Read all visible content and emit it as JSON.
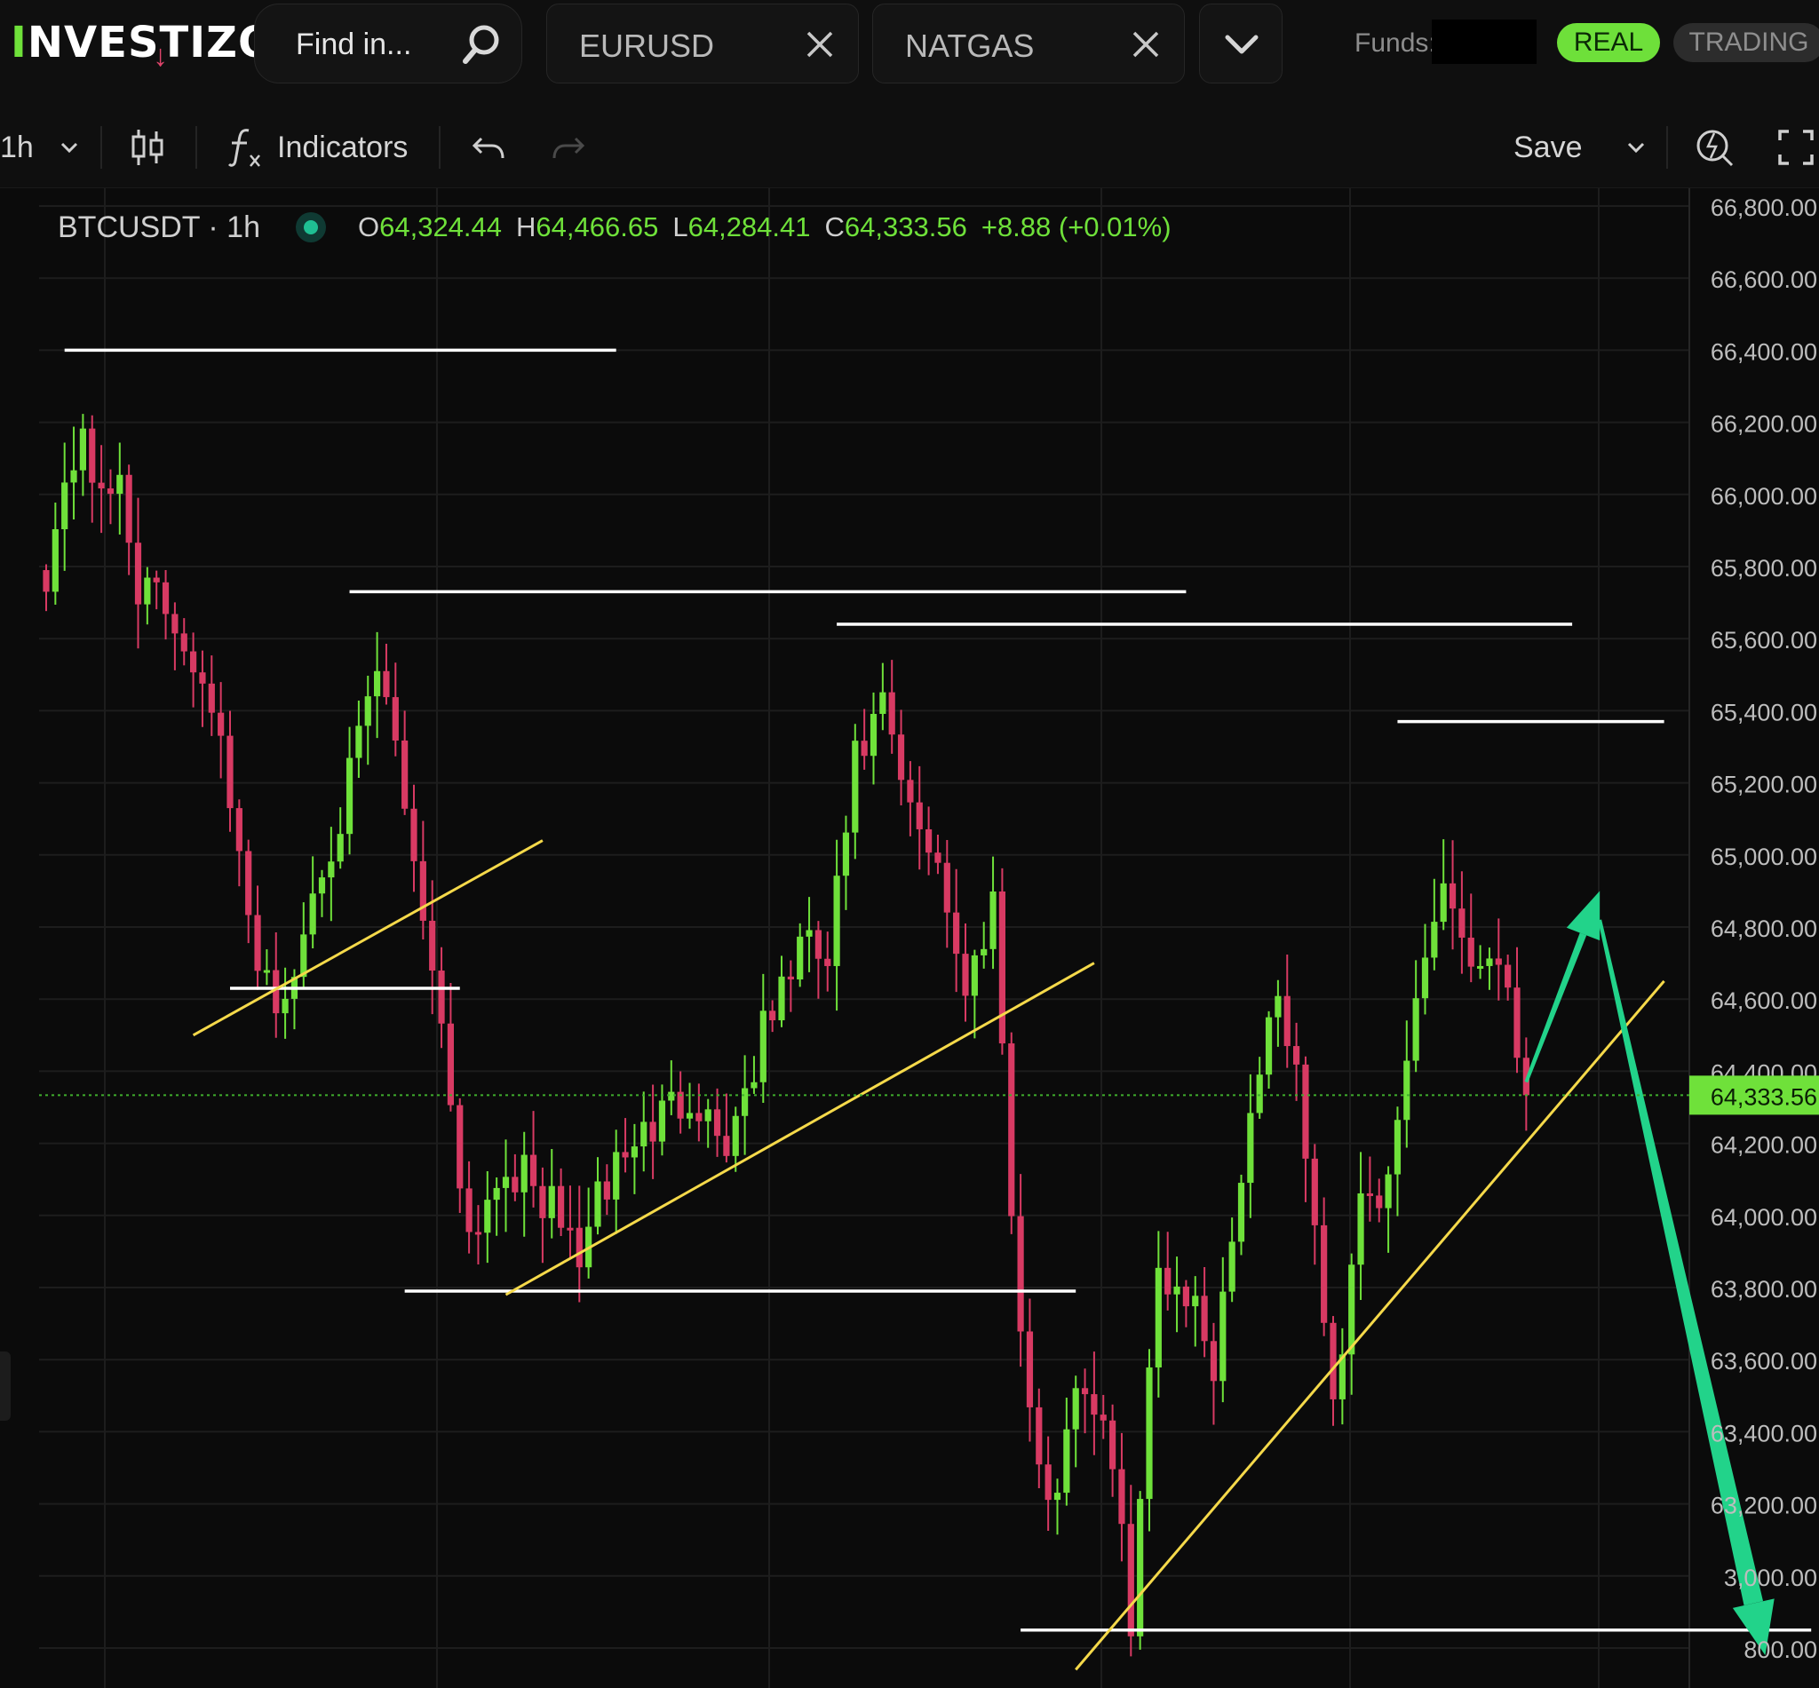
{
  "brand": {
    "first": "I",
    "rest": "NVESTIZO",
    "arrow": "↓"
  },
  "search": {
    "placeholder": "Find in..."
  },
  "tabs": [
    {
      "label": "EURUSD"
    },
    {
      "label": "NATGAS"
    }
  ],
  "account": {
    "funds_label": "Funds:",
    "real_label": "REAL",
    "trading_label": "TRADING"
  },
  "toolbar": {
    "interval": "1h",
    "indicators_label": "Indicators",
    "save_label": "Save"
  },
  "legend": {
    "symbol": "BTCUSDT · 1h",
    "o_key": "O",
    "o_val": "64,324.44",
    "h_key": "H",
    "h_val": "64,466.65",
    "l_key": "L",
    "l_val": "64,284.41",
    "c_key": "C",
    "c_val": "64,333.56",
    "change": "+8.88 (+0.01%)"
  },
  "colors": {
    "up": "#6fe13a",
    "down": "#d83a63",
    "support_line": "#ffffff",
    "trend_line": "#f5d94a",
    "arrow": "#22d38a",
    "bg": "#0b0b0b"
  },
  "chart_data": {
    "type": "candlestick",
    "symbol": "BTCUSDT",
    "interval": "1h",
    "y_axis": {
      "min": 62700,
      "max": 66900,
      "ticks": [
        {
          "value": 66800,
          "label": "66,800.00"
        },
        {
          "value": 66600,
          "label": "66,600.00"
        },
        {
          "value": 66400,
          "label": "66,400.00"
        },
        {
          "value": 66200,
          "label": "66,200.00"
        },
        {
          "value": 66000,
          "label": "66,000.00"
        },
        {
          "value": 65800,
          "label": "65,800.00"
        },
        {
          "value": 65600,
          "label": "65,600.00"
        },
        {
          "value": 65400,
          "label": "65,400.00"
        },
        {
          "value": 65200,
          "label": "65,200.00"
        },
        {
          "value": 65000,
          "label": "65,000.00"
        },
        {
          "value": 64800,
          "label": "64,800.00"
        },
        {
          "value": 64600,
          "label": "64,600.00"
        },
        {
          "value": 64400,
          "label": "64,400.00"
        },
        {
          "value": 64200,
          "label": "64,200.00"
        },
        {
          "value": 64000,
          "label": "64,000.00"
        },
        {
          "value": 63800,
          "label": "63,800.00"
        },
        {
          "value": 63600,
          "label": "63,600.00"
        },
        {
          "value": 63400,
          "label": "63,400.00"
        },
        {
          "value": 63200,
          "label": "63,200.00"
        },
        {
          "value": 63000,
          "label": "3,000.00"
        },
        {
          "value": 62800,
          "label": "800.00"
        }
      ]
    },
    "last_price": {
      "value": 64333.56,
      "label": "64,333.56"
    },
    "path_anchors": [
      [
        0,
        65800
      ],
      [
        4,
        66200
      ],
      [
        6,
        65950
      ],
      [
        8,
        66050
      ],
      [
        10,
        65750
      ],
      [
        14,
        65650
      ],
      [
        18,
        65450
      ],
      [
        22,
        64800
      ],
      [
        26,
        64550
      ],
      [
        29,
        64900
      ],
      [
        33,
        65200
      ],
      [
        36,
        65500
      ],
      [
        38,
        65300
      ],
      [
        42,
        64700
      ],
      [
        46,
        63950
      ],
      [
        50,
        64150
      ],
      [
        54,
        64050
      ],
      [
        58,
        63900
      ],
      [
        62,
        64150
      ],
      [
        66,
        64250
      ],
      [
        70,
        64350
      ],
      [
        74,
        64200
      ],
      [
        78,
        64500
      ],
      [
        82,
        64750
      ],
      [
        85,
        64700
      ],
      [
        88,
        65250
      ],
      [
        91,
        65400
      ],
      [
        94,
        65100
      ],
      [
        97,
        65000
      ],
      [
        100,
        64600
      ],
      [
        103,
        64900
      ],
      [
        106,
        63650
      ],
      [
        109,
        63150
      ],
      [
        112,
        63550
      ],
      [
        115,
        63450
      ],
      [
        118,
        62900
      ],
      [
        121,
        63850
      ],
      [
        124,
        63800
      ],
      [
        127,
        63600
      ],
      [
        131,
        64300
      ],
      [
        134,
        64650
      ],
      [
        137,
        64200
      ],
      [
        140,
        63450
      ],
      [
        143,
        64100
      ],
      [
        146,
        64050
      ],
      [
        149,
        64600
      ],
      [
        152,
        64950
      ],
      [
        155,
        64700
      ],
      [
        158,
        64750
      ],
      [
        161,
        64300
      ]
    ],
    "support_resistance_levels": [
      {
        "price": 66400,
        "from_candle": 2,
        "to_candle": 62
      },
      {
        "price": 65730,
        "from_candle": 33,
        "to_candle": 124
      },
      {
        "price": 65640,
        "from_candle": 86,
        "to_candle": 166
      },
      {
        "price": 65370,
        "from_candle": 147,
        "to_candle": 176
      },
      {
        "price": 64630,
        "from_candle": 20,
        "to_candle": 45
      },
      {
        "price": 63790,
        "from_candle": 39,
        "to_candle": 112
      },
      {
        "price": 62850,
        "from_candle": 106,
        "to_candle": 192
      }
    ],
    "trend_lines": [
      {
        "from": [
          16,
          64500
        ],
        "to": [
          54,
          65040
        ]
      },
      {
        "from": [
          50,
          63780
        ],
        "to": [
          114,
          64700
        ]
      },
      {
        "from": [
          112,
          62740
        ],
        "to": [
          176,
          64650
        ]
      }
    ],
    "projection_arrows": [
      {
        "from": [
          161,
          64370
        ],
        "to": [
          169,
          64900
        ]
      },
      {
        "from": [
          169,
          64820
        ],
        "to": [
          187,
          62780
        ]
      }
    ]
  }
}
